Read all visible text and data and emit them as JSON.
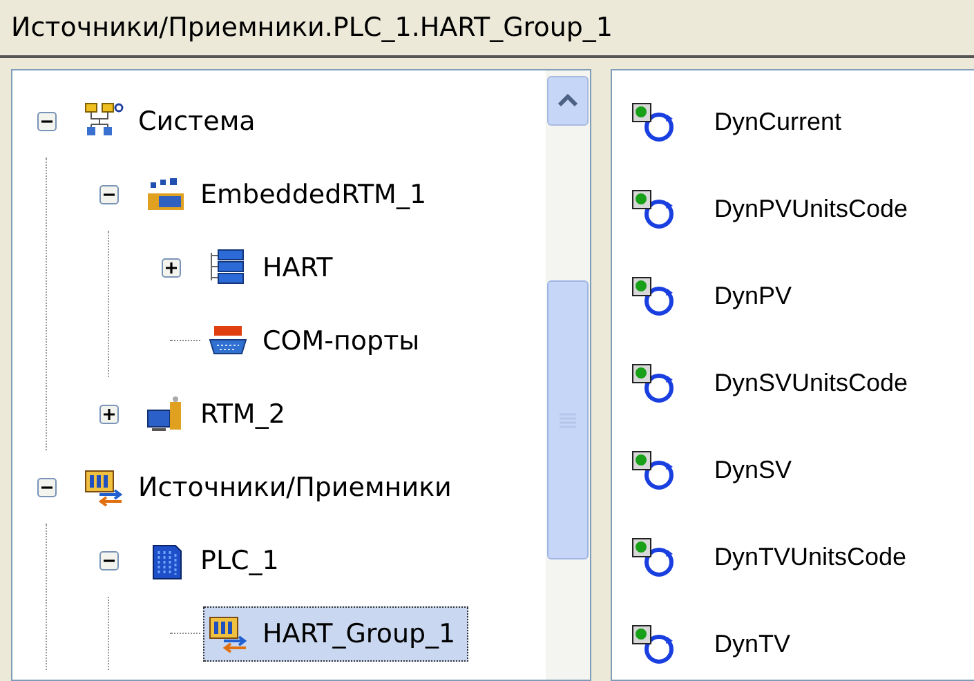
{
  "path_bar": {
    "text": "Источники/Приемники.PLC_1.HART_Group_1"
  },
  "tree": {
    "items": [
      {
        "label": "Система",
        "kind": "system",
        "expanded": true,
        "selected": false,
        "children": [
          {
            "label": "EmbeddedRTM_1",
            "kind": "rtm",
            "expanded": true,
            "selected": false,
            "children": [
              {
                "label": "HART",
                "kind": "hart",
                "expanded": false,
                "selected": false
              },
              {
                "label": "COM-порты",
                "kind": "com",
                "selected": false
              }
            ]
          },
          {
            "label": "RTM_2",
            "kind": "rtm2",
            "expanded": false,
            "selected": false
          }
        ]
      },
      {
        "label": "Источники/Приемники",
        "kind": "io",
        "expanded": true,
        "selected": false,
        "children": [
          {
            "label": "PLC_1",
            "kind": "plc",
            "expanded": true,
            "selected": false,
            "children": [
              {
                "label": "HART_Group_1",
                "kind": "io",
                "selected": true
              }
            ]
          }
        ]
      }
    ]
  },
  "list": {
    "items": [
      {
        "label": "DynCurrent"
      },
      {
        "label": "DynPVUnitsCode"
      },
      {
        "label": "DynPV"
      },
      {
        "label": "DynSVUnitsCode"
      },
      {
        "label": "DynSV"
      },
      {
        "label": "DynTVUnitsCode"
      },
      {
        "label": "DynTV"
      }
    ]
  }
}
